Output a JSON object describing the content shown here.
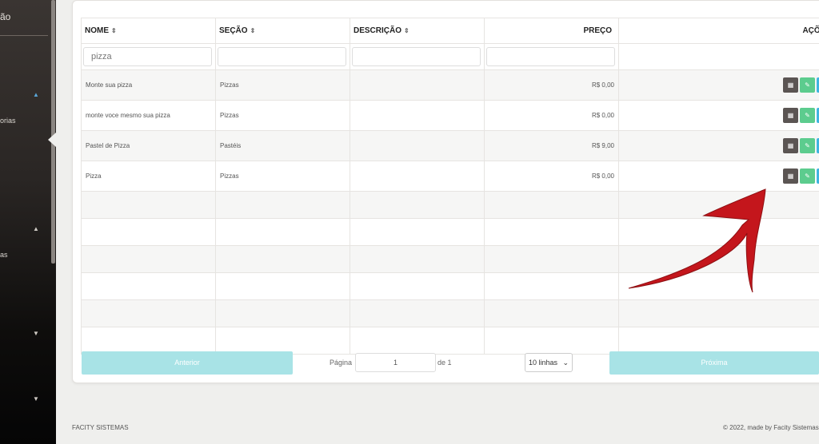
{
  "sidebar": {
    "labels": [
      "ão",
      "orias",
      "as"
    ]
  },
  "table": {
    "headers": {
      "name": "NOME",
      "section": "SEÇÃO",
      "description": "DESCRIÇÃO",
      "price": "PREÇO",
      "actions": "AÇÕES"
    },
    "filters": {
      "name_value": "pizza",
      "section_value": "",
      "description_value": "",
      "price_value": ""
    },
    "rows": [
      {
        "name": "Monte sua pizza",
        "section": "Pizzas",
        "description": "",
        "price": "R$ 0,00"
      },
      {
        "name": "monte voce mesmo sua pizza",
        "section": "Pizzas",
        "description": "",
        "price": "R$ 0,00"
      },
      {
        "name": "Pastel de Pizza",
        "section": "Pastéis",
        "description": "",
        "price": "R$ 9,00"
      },
      {
        "name": "Pizza",
        "section": "Pizzas",
        "description": "",
        "price": "R$ 0,00"
      }
    ],
    "action_icons": [
      "grid-icon",
      "edit-icon",
      "copy-icon",
      "delete-icon"
    ]
  },
  "pagination": {
    "previous_label": "Anterior",
    "page_label": "Página",
    "page_value": "1",
    "of_label": "de 1",
    "rows_select": "10 linhas",
    "next_label": "Próxima"
  },
  "footer": {
    "left": "FACITY SISTEMAS",
    "right": "© 2022, made by Facity Sistemas"
  },
  "colors": {
    "accent_teal": "#a8e3e6",
    "annotation_arrow": "#c4161c"
  }
}
